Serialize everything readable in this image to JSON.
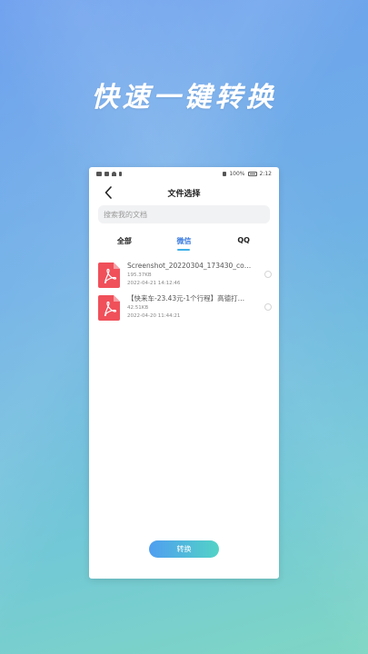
{
  "headline": "快速一键转换",
  "status": {
    "left_icons": [
      "sim-icon",
      "signal-icon",
      "wifi-icon",
      "usb-icon"
    ],
    "vibrate": "vibrate-icon",
    "battery": "100%",
    "time": "2:12"
  },
  "nav": {
    "title": "文件选择"
  },
  "search": {
    "placeholder": "搜索我的文档"
  },
  "tabs": [
    {
      "label": "全部",
      "active": false
    },
    {
      "label": "微信",
      "active": true
    },
    {
      "label": "QQ",
      "active": false
    }
  ],
  "files": [
    {
      "name": "Screenshot_20220304_173430_co…",
      "size": "195.37KB",
      "time": "2022-04-21 14:12:46",
      "icon": "pdf-icon"
    },
    {
      "name": "【快来车-23.43元-1个行程】高德打…",
      "size": "42.51KB",
      "time": "2022-04-20 11:44:21",
      "icon": "pdf-icon"
    }
  ],
  "convert_label": "转换",
  "colors": {
    "accent": "#3fb0e8",
    "pdf_red": "#f0505a",
    "button_start": "#4f9ef0",
    "button_end": "#52d3c6"
  }
}
